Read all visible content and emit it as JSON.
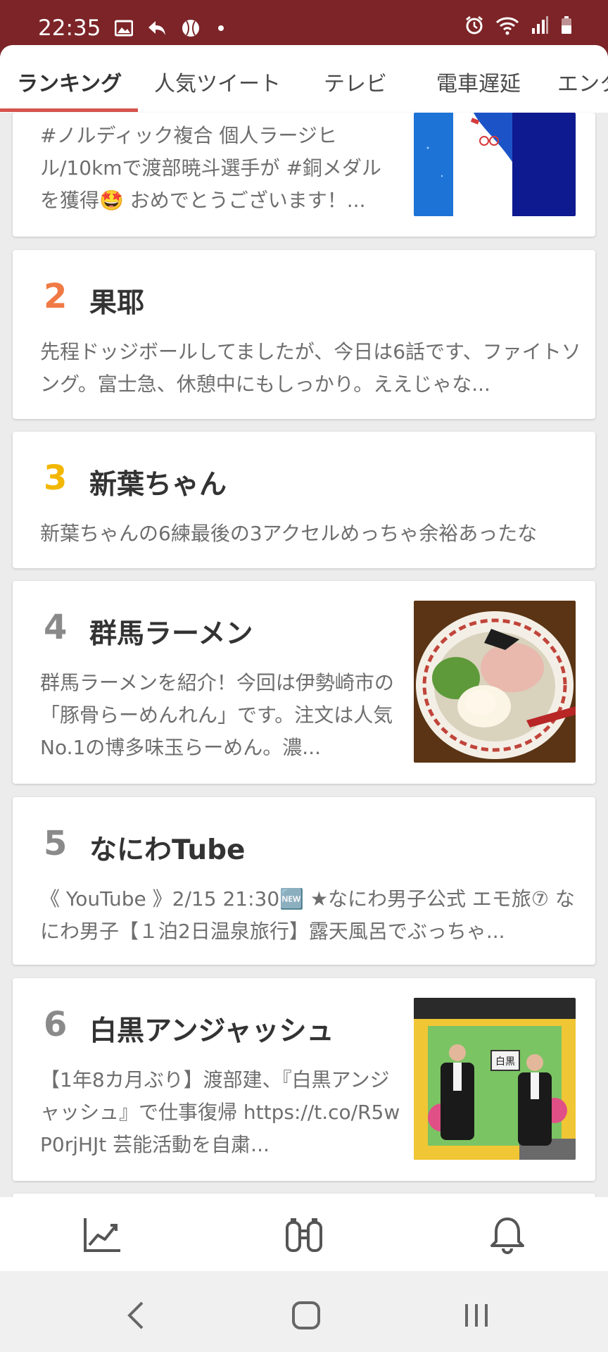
{
  "status_bar": {
    "time": "22:35",
    "left_icons": [
      "image-icon",
      "reply-icon",
      "baseball-icon",
      "dot-icon"
    ],
    "right_icons": [
      "alarm-icon",
      "wifi-icon",
      "signal-icon",
      "battery-icon"
    ]
  },
  "tabs": [
    {
      "label": "ランキング",
      "active": true
    },
    {
      "label": "人気ツイート",
      "active": false
    },
    {
      "label": "テレビ",
      "active": false
    },
    {
      "label": "電車遅延",
      "active": false
    },
    {
      "label": "エンタ",
      "active": false
    }
  ],
  "items": [
    {
      "rank": "",
      "title": "",
      "desc": "#ノルディック複合 個人ラージヒル/10kmで渡部暁斗選手が #銅メダル を獲得🤩 おめでとうございます！...",
      "has_image": true,
      "image": "ski-jump-photo"
    },
    {
      "rank": "2",
      "title": "果耶",
      "desc": "先程ドッジボールしてましたが、今日は6話です、ファイトソング。富士急、休憩中にもしっかり。ええじゃな...",
      "rank_color": "#f07a45",
      "has_image": false
    },
    {
      "rank": "3",
      "title": "新葉ちゃん",
      "desc": "新葉ちゃんの6練最後の3アクセルめっちゃ余裕あったな",
      "rank_color": "#f2b700",
      "has_image": false
    },
    {
      "rank": "4",
      "title": "群馬ラーメン",
      "desc": "群馬ラーメンを紹介！今回は伊勢崎市の「豚骨らーめんれん」です。注文は人気No.1の博多味玉らーめん。濃...",
      "rank_color": "#8a8a8a",
      "has_image": true,
      "image": "ramen-photo"
    },
    {
      "rank": "5",
      "title": "なにわTube",
      "desc": "《 YouTube 》2/15 21:30🆕 ★なにわ男子公式 エモ旅⑦ なにわ男子【１泊2日温泉旅行】露天風呂でぶっちゃ...",
      "rank_color": "#8a8a8a",
      "has_image": false
    },
    {
      "rank": "6",
      "title": "白黒アンジャッシュ",
      "desc": "【1年8カ月ぶり】渡部建、『白黒アンジャッシュ』で仕事復帰 https://t.co/R5wP0rjHJt 芸能活動を自粛...",
      "rank_color": "#8a8a8a",
      "has_image": true,
      "image": "tv-studio-photo"
    }
  ],
  "thumb_text": {
    "studio_sign": "白黒"
  },
  "bottom_nav": [
    "trend-chart-icon",
    "binoculars-icon",
    "bell-icon"
  ],
  "system_nav": [
    "back-icon",
    "home-icon",
    "recents-icon"
  ],
  "colors": {
    "status_bar": "#7c2427",
    "accent": "#d6544c"
  }
}
